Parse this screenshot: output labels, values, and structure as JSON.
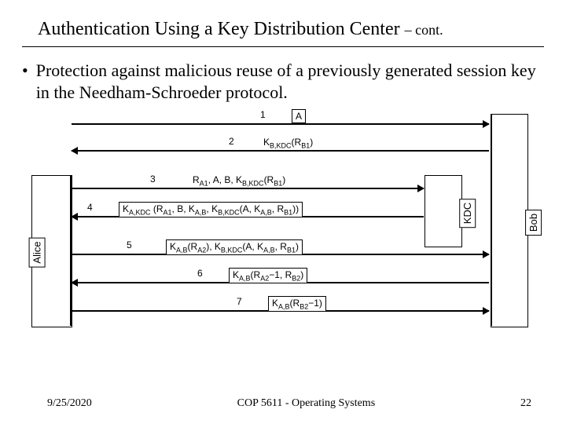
{
  "title": {
    "main": "Authentication Using a Key Distribution Center",
    "cont": "– cont."
  },
  "bullet": {
    "text": "Protection against malicious reuse of a previously generated session key in the Needham-Schroeder protocol."
  },
  "parties": {
    "alice": "Alice",
    "kdc": "KDC",
    "bob": "Bob"
  },
  "messages": {
    "m1": {
      "num": "1",
      "label": "A"
    },
    "m2": {
      "num": "2",
      "label_html": "K<span class='sub'>B,KDC</span>(R<span class='sub'>B1</span>)"
    },
    "m3": {
      "num": "3",
      "label_html": "R<span class='sub'>A1</span>, A, B, K<span class='sub'>B,KDC</span>(R<span class='sub'>B1</span>)"
    },
    "m4": {
      "num": "4",
      "label_html": "K<span class='sub'>A,KDC</span> (R<span class='sub'>A1</span>, B, K<span class='sub'>A,B</span>, K<span class='sub'>B,KDC</span>(A, K<span class='sub'>A,B</span>, R<span class='sub'>B1</span>))"
    },
    "m5": {
      "num": "5",
      "label_html": "K<span class='sub'>A,B</span>(R<span class='sub'>A2</span>), K<span class='sub'>B,KDC</span>(A, K<span class='sub'>A,B</span>, R<span class='sub'>B1</span>)"
    },
    "m6": {
      "num": "6",
      "label_html": "K<span class='sub'>A,B</span>(R<span class='sub'>A2</span>−1, R<span class='sub'>B2</span>)"
    },
    "m7": {
      "num": "7",
      "label_html": "K<span class='sub'>A,B</span>(R<span class='sub'>B2</span>−1)"
    }
  },
  "footer": {
    "date": "9/25/2020",
    "course": "COP 5611 - Operating Systems",
    "page": "22"
  }
}
